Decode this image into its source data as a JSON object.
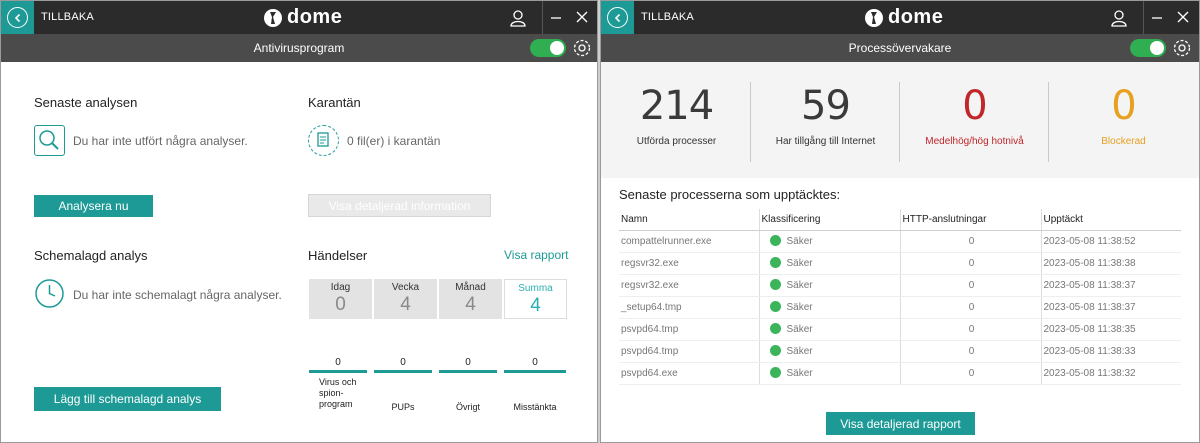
{
  "left": {
    "titlebar": {
      "back_label": "TILLBAKA",
      "logo_text": "dome"
    },
    "subbar": {
      "title": "Antivirusprogram"
    },
    "last_scan": {
      "title": "Senaste analysen",
      "text": "Du har inte utfört några analyser.",
      "button": "Analysera nu"
    },
    "quarantine": {
      "title": "Karantän",
      "text": "0 fil(er) i karantän",
      "button": "Visa detaljerad information"
    },
    "scheduled": {
      "title": "Schemalagd analys",
      "text": "Du har inte schemalagt några analyser.",
      "button": "Lägg till schemalagd analys"
    },
    "events": {
      "title": "Händelser",
      "link": "Visa rapport",
      "periods": [
        {
          "label": "Idag",
          "value": "0"
        },
        {
          "label": "Vecka",
          "value": "4"
        },
        {
          "label": "Månad",
          "value": "4"
        },
        {
          "label": "Summa",
          "value": "4"
        }
      ],
      "categories": [
        {
          "label": "Virus och spion-program",
          "value": "0"
        },
        {
          "label": "PUPs",
          "value": "0"
        },
        {
          "label": "Övrigt",
          "value": "0"
        },
        {
          "label": "Misstänkta",
          "value": "0"
        }
      ]
    }
  },
  "right": {
    "titlebar": {
      "back_label": "TILLBAKA",
      "logo_text": "dome"
    },
    "subbar": {
      "title": "Processövervakare"
    },
    "stats": [
      {
        "value": "214",
        "label": "Utförda processer",
        "color": "#3a3a3a",
        "label_color": "#333333"
      },
      {
        "value": "59",
        "label": "Har tillgång till Internet",
        "color": "#3a3a3a",
        "label_color": "#333333"
      },
      {
        "value": "0",
        "label": "Medelhög/hög hotnivå",
        "color": "#c0262a",
        "label_color": "#c0262a"
      },
      {
        "value": "0",
        "label": "Blockerad",
        "color": "#e8a020",
        "label_color": "#e8a020"
      }
    ],
    "process_title": "Senaste processerna som upptäcktes:",
    "columns": [
      "Namn",
      "Klassificering",
      "HTTP-anslutningar",
      "Upptäckt"
    ],
    "rows": [
      {
        "name": "compattelrunner.exe",
        "class": "Säker",
        "http": "0",
        "time": "2023-05-08 11:38:52"
      },
      {
        "name": "regsvr32.exe",
        "class": "Säker",
        "http": "0",
        "time": "2023-05-08 11:38:38"
      },
      {
        "name": "regsvr32.exe",
        "class": "Säker",
        "http": "0",
        "time": "2023-05-08 11:38:37"
      },
      {
        "name": "_setup64.tmp",
        "class": "Säker",
        "http": "0",
        "time": "2023-05-08 11:38:37"
      },
      {
        "name": "psvpd64.tmp",
        "class": "Säker",
        "http": "0",
        "time": "2023-05-08 11:38:35"
      },
      {
        "name": "psvpd64.tmp",
        "class": "Säker",
        "http": "0",
        "time": "2023-05-08 11:38:33"
      },
      {
        "name": "psvpd64.exe",
        "class": "Säker",
        "http": "0",
        "time": "2023-05-08 11:38:32"
      }
    ],
    "report_button": "Visa detaljerad rapport"
  },
  "colors": {
    "accent": "#1d9a96",
    "titlebar": "#2b2b2b",
    "subbar": "#4b4b4b",
    "toggle_on": "#2fae52",
    "safe": "#3cb45a"
  },
  "icons": [
    "back-icon",
    "dome-logo-icon",
    "user-icon",
    "minimize-icon",
    "close-icon",
    "gear-icon",
    "search-icon",
    "quarantine-icon",
    "clock-icon"
  ]
}
